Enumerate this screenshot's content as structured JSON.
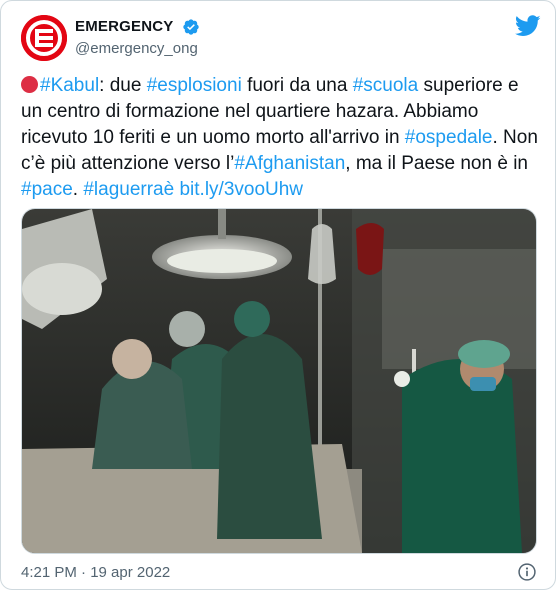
{
  "author": {
    "display_name": "EMERGENCY",
    "handle": "@emergency_ong",
    "verified": true,
    "brand_color": "#e30613"
  },
  "tweet": {
    "parts": [
      {
        "type": "emoji",
        "name": "red-circle"
      },
      {
        "type": "hashtag",
        "text": "#Kabul"
      },
      {
        "type": "text",
        "text": ": due "
      },
      {
        "type": "hashtag",
        "text": "#esplosioni"
      },
      {
        "type": "text",
        "text": " fuori da una "
      },
      {
        "type": "hashtag",
        "text": "#scuola"
      },
      {
        "type": "text",
        "text": " superiore e un centro di formazione nel quartiere hazara. Abbiamo ricevuto 10 feriti e un uomo morto all'arrivo in "
      },
      {
        "type": "hashtag",
        "text": "#ospedale"
      },
      {
        "type": "text",
        "text": ". Non c’è più attenzione verso l’"
      },
      {
        "type": "hashtag",
        "text": "#Afghanistan"
      },
      {
        "type": "text",
        "text": ", ma il Paese non è in "
      },
      {
        "type": "hashtag",
        "text": "#pace"
      },
      {
        "type": "text",
        "text": ". "
      },
      {
        "type": "hashtag",
        "text": "#laguerraè"
      },
      {
        "type": "text",
        "text": " "
      },
      {
        "type": "link",
        "text": "bit.ly/3vooUhw"
      }
    ],
    "link_color": "#1d9bf0"
  },
  "media": {
    "icon": "photo-operating-room"
  },
  "meta": {
    "timestamp": "4:21 PM · 19 apr 2022"
  },
  "icons": {
    "logo": "twitter-bird-icon",
    "verified": "verified-badge-icon",
    "info": "info-icon"
  }
}
